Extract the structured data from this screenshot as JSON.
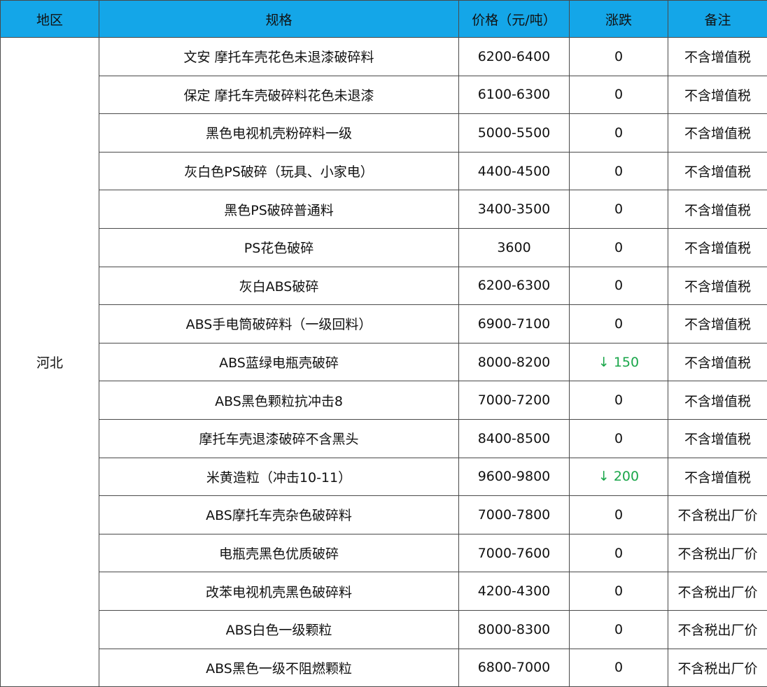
{
  "headers": {
    "region": "地区",
    "spec": "规格",
    "price": "价格（元/吨）",
    "change": "涨跌",
    "note": "备注"
  },
  "region": "河北",
  "rows": [
    {
      "spec": "文安 摩托车壳花色未退漆破碎料",
      "price": "6200-6400",
      "change": "0",
      "note": "不含增值税"
    },
    {
      "spec": "保定 摩托车壳破碎料花色未退漆",
      "price": "6100-6300",
      "change": "0",
      "note": "不含增值税"
    },
    {
      "spec": "黑色电视机壳粉碎料一级",
      "price": "5000-5500",
      "change": "0",
      "note": "不含增值税"
    },
    {
      "spec": "灰白色PS破碎（玩具、小家电）",
      "price": "4400-4500",
      "change": "0",
      "note": "不含增值税"
    },
    {
      "spec": "黑色PS破碎普通料",
      "price": "3400-3500",
      "change": "0",
      "note": "不含增值税"
    },
    {
      "spec": "PS花色破碎",
      "price": "3600",
      "change": "0",
      "note": "不含增值税"
    },
    {
      "spec": "灰白ABS破碎",
      "price": "6200-6300",
      "change": "0",
      "note": "不含增值税"
    },
    {
      "spec": "ABS手电筒破碎料（一级回料）",
      "price": "6900-7100",
      "change": "0",
      "note": "不含增值税"
    },
    {
      "spec": "ABS蓝绿电瓶壳破碎",
      "price": "8000-8200",
      "change": "↓ 150",
      "note": "不含增值税",
      "trend": "down"
    },
    {
      "spec": "ABS黑色颗粒抗冲击8",
      "price": "7000-7200",
      "change": "0",
      "note": "不含增值税"
    },
    {
      "spec": "摩托车壳退漆破碎不含黑头",
      "price": "8400-8500",
      "change": "0",
      "note": "不含增值税"
    },
    {
      "spec": "米黄造粒（冲击10-11）",
      "price": "9600-9800",
      "change": "↓ 200",
      "note": "不含增值税",
      "trend": "down"
    },
    {
      "spec": "ABS摩托车壳杂色破碎料",
      "price": "7000-7800",
      "change": "0",
      "note": "不含税出厂价"
    },
    {
      "spec": "电瓶壳黑色优质破碎",
      "price": "7000-7600",
      "change": "0",
      "note": "不含税出厂价"
    },
    {
      "spec": "改苯电视机壳黑色破碎料",
      "price": "4200-4300",
      "change": "0",
      "note": "不含税出厂价"
    },
    {
      "spec": "ABS白色一级颗粒",
      "price": "8000-8300",
      "change": "0",
      "note": "不含税出厂价"
    },
    {
      "spec": "ABS黑色一级不阻燃颗粒",
      "price": "6800-7000",
      "change": "0",
      "note": "不含税出厂价"
    }
  ],
  "colors": {
    "header_bg": "#14a6e8",
    "down": "#1aa64a"
  }
}
